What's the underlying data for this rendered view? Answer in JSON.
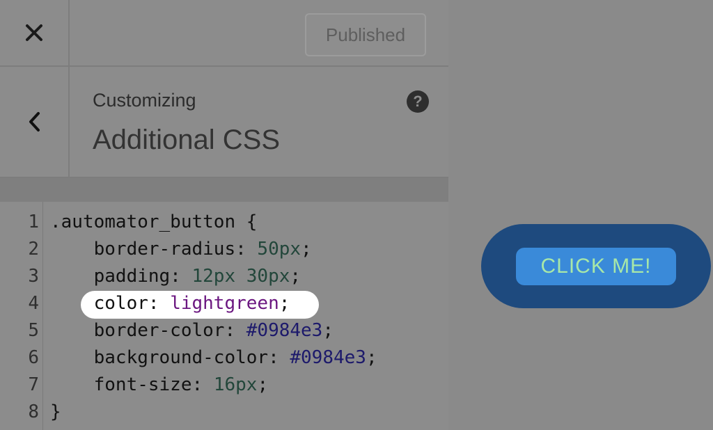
{
  "topbar": {
    "close_icon": "close-icon",
    "published_label": "Published"
  },
  "header": {
    "back_icon": "chevron-left-icon",
    "customizing_label": "Customizing",
    "section_title": "Additional CSS",
    "help_icon": "help-icon",
    "help_glyph": "?"
  },
  "editor": {
    "line_numbers": [
      "1",
      "2",
      "3",
      "4",
      "5",
      "6",
      "7",
      "8"
    ],
    "lines": [
      {
        "prop": ".automator_button {",
        "value": "",
        "end": ""
      },
      {
        "prop": "    border-radius: ",
        "value": "50px",
        "end": ";"
      },
      {
        "prop": "    padding: ",
        "value": "12px 30px",
        "end": ";"
      },
      {
        "prop": "    color: ",
        "value": "lightgreen",
        "end": ";"
      },
      {
        "prop": "    border-color: ",
        "value": "#0984e3",
        "end": ";"
      },
      {
        "prop": "    background-color: ",
        "value": "#0984e3",
        "end": ";"
      },
      {
        "prop": "    font-size: ",
        "value": "16px",
        "end": ";"
      },
      {
        "prop": "}",
        "value": "",
        "end": ""
      }
    ]
  },
  "preview": {
    "button_label": "CLICK ME!",
    "outer_color": "#1e4a7e",
    "button_color": "#3a8ad9",
    "text_color": "#a8e8a8"
  }
}
